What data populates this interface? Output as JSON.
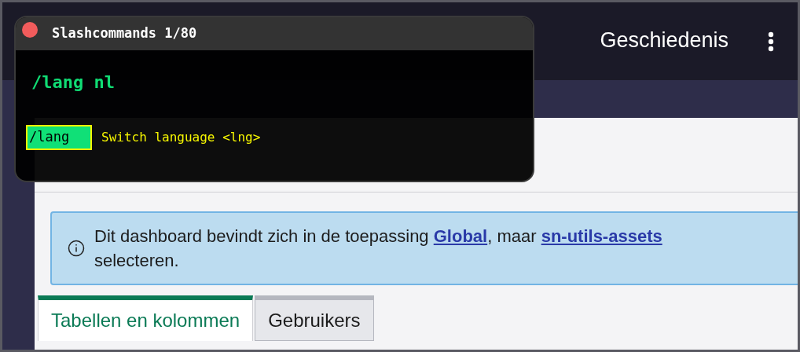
{
  "header": {
    "history_button": "Geschiedenis"
  },
  "slash_popup": {
    "title": "Slashcommands 1/80",
    "input": "/lang nl",
    "suggestions": [
      {
        "command": "/lang",
        "description": "Switch language <lng>",
        "selected": true
      }
    ]
  },
  "info_banner": {
    "parts": [
      {
        "kind": "text",
        "text": "Dit dashboard bevindt zich in de toepassing "
      },
      {
        "kind": "link",
        "text": "Global"
      },
      {
        "kind": "text",
        "text": ", maar "
      },
      {
        "kind": "link",
        "text": "sn-utils-assets"
      },
      {
        "kind": "break"
      },
      {
        "kind": "text",
        "text": "selecteren."
      }
    ]
  },
  "tabs": [
    {
      "label": "Tabellen en kolommen",
      "selected": true
    },
    {
      "label": "Gebruikers",
      "selected": false
    }
  ]
}
